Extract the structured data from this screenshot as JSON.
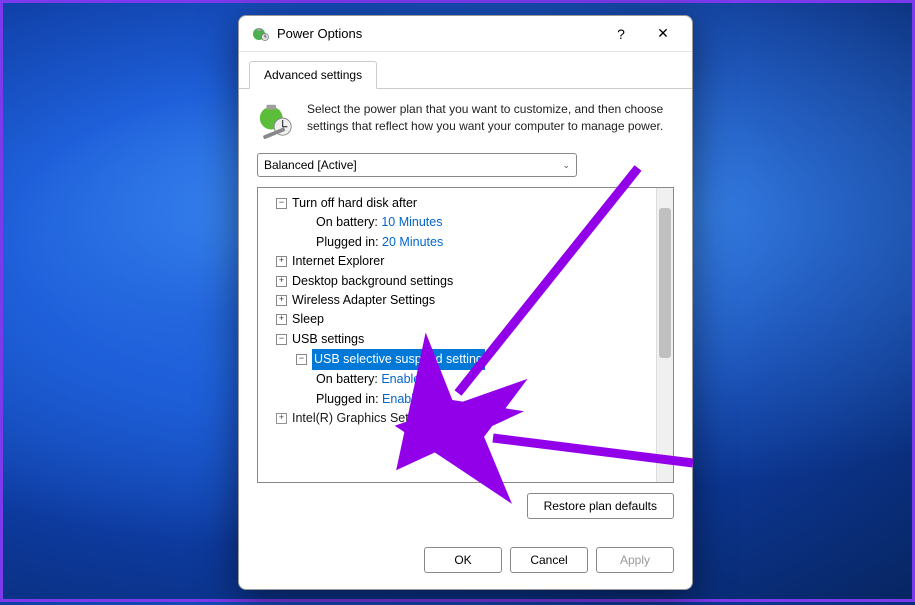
{
  "window": {
    "title": "Power Options",
    "help_glyph": "?",
    "close_glyph": "✕"
  },
  "tabs": {
    "advanced": "Advanced settings"
  },
  "intro": "Select the power plan that you want to customize, and then choose settings that reflect how you want your computer to manage power.",
  "plan_select": {
    "value": "Balanced [Active]"
  },
  "tree": {
    "hard_disk": {
      "label": "Turn off hard disk after",
      "on_battery_label": "On battery:",
      "on_battery_value": "10 Minutes",
      "plugged_in_label": "Plugged in:",
      "plugged_in_value": "20 Minutes"
    },
    "internet_explorer": "Internet Explorer",
    "desktop_bg": "Desktop background settings",
    "wireless": "Wireless Adapter Settings",
    "sleep": "Sleep",
    "usb": {
      "label": "USB settings",
      "selective": {
        "label": "USB selective suspend setting",
        "on_battery_label": "On battery:",
        "on_battery_value": "Enabled",
        "plugged_in_label": "Plugged in:",
        "plugged_in_value": "Enabled"
      }
    },
    "graphics": "Intel(R) Graphics Settings"
  },
  "buttons": {
    "restore": "Restore plan defaults",
    "ok": "OK",
    "cancel": "Cancel",
    "apply": "Apply"
  },
  "glyphs": {
    "plus": "+",
    "minus": "−",
    "chevron_down": "⌄"
  }
}
